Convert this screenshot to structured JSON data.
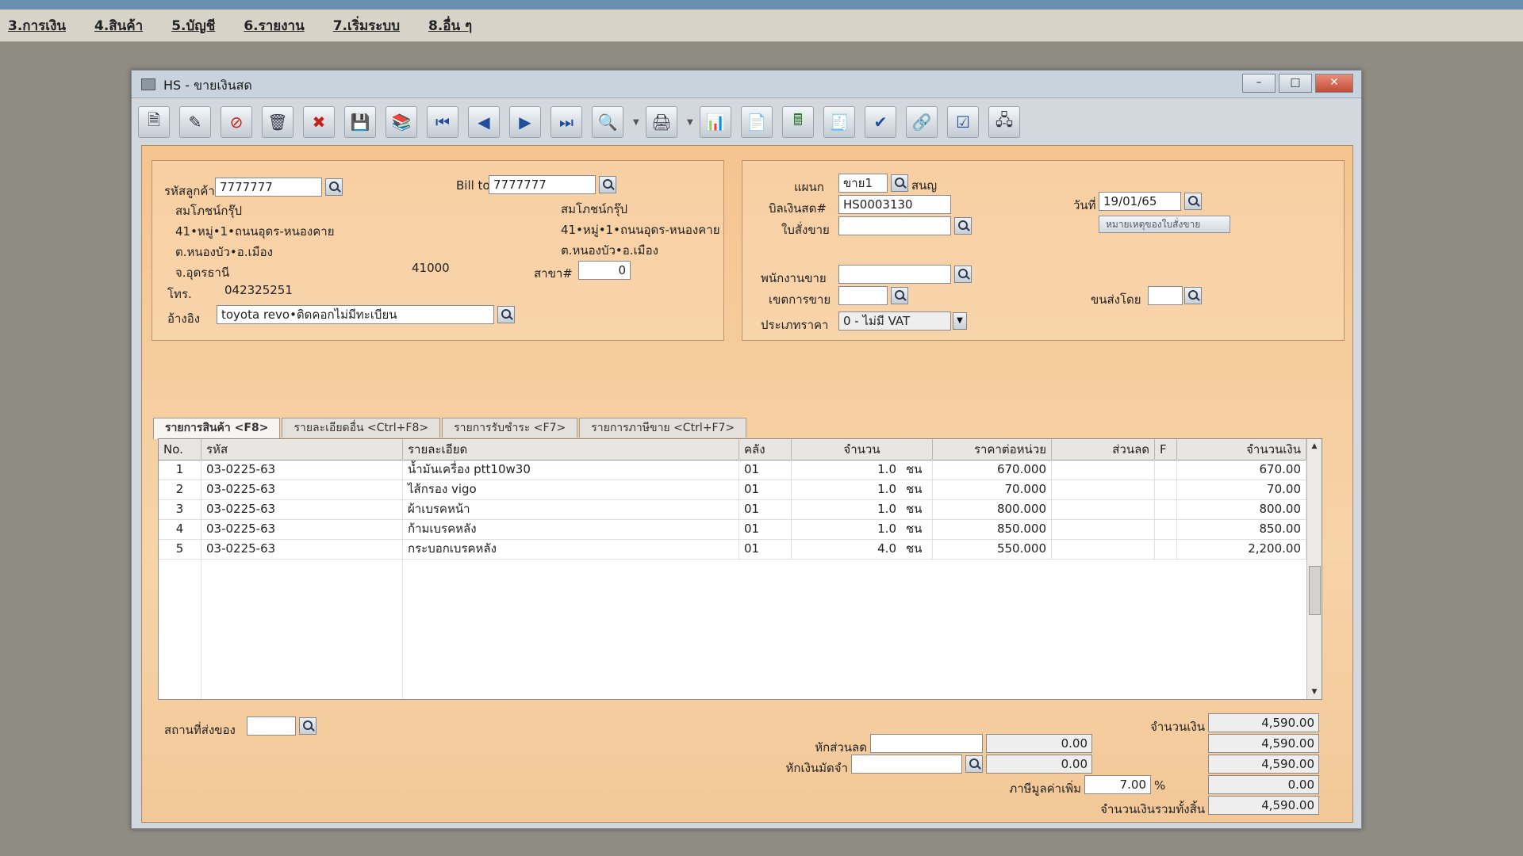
{
  "menubar": {
    "items": [
      "3.การเงิน",
      "4.สินค้า",
      "5.บัญชี",
      "6.รายงาน",
      "7.เริ่มระบบ",
      "8.อื่น ๆ"
    ]
  },
  "window": {
    "title": "HS - ขายเงินสด"
  },
  "toolbar": {
    "icons": [
      "new-doc-icon",
      "edit-icon",
      "void-icon",
      "trash-icon",
      "cancel-icon",
      "save-icon",
      "books-icon",
      "first-record-icon",
      "previous-record-icon",
      "next-record-icon",
      "last-record-icon",
      "search-icon",
      "print-icon",
      "report-icon",
      "document-icon",
      "calculator-icon",
      "receipt-icon",
      "ok-stamp-icon",
      "link-icon",
      "approve-icon",
      "network-icon"
    ]
  },
  "customer": {
    "code_label": "รหัสลูกค้า",
    "code": "7777777",
    "name": "สมโภชน์กรุ๊ป",
    "address1": "41•หมู่•1•ถนนอุดร-หนองคาย",
    "address2": "ต.หนองบัว•อ.เมือง",
    "province": "จ.อุดรธานี",
    "postcode": "41000",
    "phone_label": "โทร.",
    "phone": "042325251",
    "ref_label": "อ้างอิง",
    "ref": "toyota revo•ติดคอกไม่มีทะเบียน"
  },
  "billto": {
    "label": "Bill to",
    "code": "7777777",
    "name": "สมโภชน์กรุ๊ป",
    "address1": "41•หมู่•1•ถนนอุดร-หนองคาย",
    "address2": "ต.หนองบัว•อ.เมือง",
    "branch_label": "สาขา#",
    "branch": "0"
  },
  "doc": {
    "dept_label": "แผนก",
    "dept": "ขาย1",
    "dept_name": "สนญ",
    "bill_label": "บิลเงินสด#",
    "bill_no": "HS0003130",
    "date_label": "วันที่",
    "date": "19/01/65",
    "order_label": "ใบสั่งขาย",
    "order": "",
    "remark_btn": "หมายเหตุของใบสั่งขาย",
    "salesman_label": "พนักงานขาย",
    "salesman": "",
    "area_label": "เขตการขาย",
    "area": "",
    "ship_label": "ขนส่งโดย",
    "ship": "",
    "pricetype_label": "ประเภทราคา",
    "pricetype": "0 - ไม่มี VAT"
  },
  "tabs": [
    "รายการสินค้า <F8>",
    "รายละเอียดอื่น <Ctrl+F8>",
    "รายการรับชำระ <F7>",
    "รายการภาษีขาย <Ctrl+F7>"
  ],
  "grid": {
    "headers": [
      "No.",
      "รหัส",
      "รายละเอียด",
      "คลัง",
      "จำนวน",
      "ราคาต่อหน่วย",
      "ส่วนลด",
      "F",
      "จำนวนเงิน"
    ],
    "rows": [
      {
        "no": "1",
        "code": "03-0225-63",
        "desc": "น้ำมันเครื่อง ptt10w30",
        "wh": "01",
        "qty": "1.0",
        "unit": "ชน",
        "price": "670.000",
        "disc": "",
        "f": "",
        "amount": "670.00"
      },
      {
        "no": "2",
        "code": "03-0225-63",
        "desc": "ไส้กรอง vigo",
        "wh": "01",
        "qty": "1.0",
        "unit": "ชน",
        "price": "70.000",
        "disc": "",
        "f": "",
        "amount": "70.00"
      },
      {
        "no": "3",
        "code": "03-0225-63",
        "desc": "ผ้าเบรคหน้า",
        "wh": "01",
        "qty": "1.0",
        "unit": "ชน",
        "price": "800.000",
        "disc": "",
        "f": "",
        "amount": "800.00"
      },
      {
        "no": "4",
        "code": "03-0225-63",
        "desc": "ก้ามเบรคหลัง",
        "wh": "01",
        "qty": "1.0",
        "unit": "ชน",
        "price": "850.000",
        "disc": "",
        "f": "",
        "amount": "850.00"
      },
      {
        "no": "5",
        "code": "03-0225-63",
        "desc": "กระบอกเบรคหลัง",
        "wh": "01",
        "qty": "4.0",
        "unit": "ชน",
        "price": "550.000",
        "disc": "",
        "f": "",
        "amount": "2,200.00"
      }
    ]
  },
  "footer": {
    "delivery_label": "สถานที่ส่งของ",
    "delivery": "",
    "amount_label": "จำนวนเงิน",
    "amount": "4,590.00",
    "discount_label": "หักส่วนลด",
    "discount_text": "",
    "discount_value": "0.00",
    "after_discount": "4,590.00",
    "deposit_label": "หักเงินมัดจำ",
    "deposit_text": "",
    "deposit_value": "0.00",
    "after_deposit": "4,590.00",
    "vat_label": "ภาษีมูลค่าเพิ่ม",
    "vat_rate": "7.00",
    "vat_pct_sign": "%",
    "vat_amount": "0.00",
    "total_label": "จำนวนเงินรวมทั้งสิ้น",
    "total": "4,590.00"
  }
}
